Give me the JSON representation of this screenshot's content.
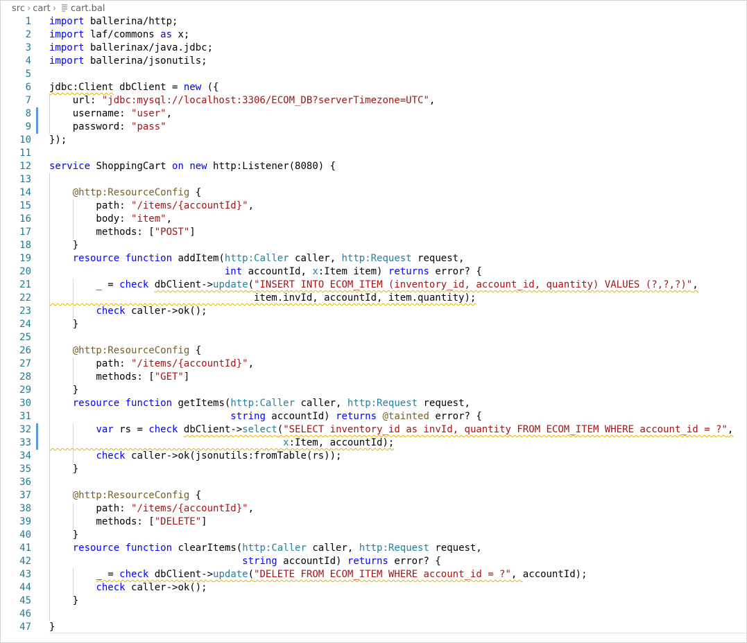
{
  "breadcrumb": {
    "items": [
      "src",
      "cart"
    ],
    "file": "cart.bal",
    "file_icon": "file-lines-icon"
  },
  "colors": {
    "keyword": "#0000ff",
    "string": "#a31515",
    "annotation": "#795e26",
    "type": "#267f99",
    "line_number": "#237893",
    "warning_squiggle": "#e5b300",
    "modified_gutter": "#5b9bd5"
  },
  "editor": {
    "modified_lines": [
      8,
      9,
      32,
      33
    ],
    "lines": [
      {
        "n": "1",
        "code": "import ballerina/http;"
      },
      {
        "n": "2",
        "code": "import laf/commons as x;"
      },
      {
        "n": "3",
        "code": "import ballerinax/java.jdbc;"
      },
      {
        "n": "4",
        "code": "import ballerina/jsonutils;"
      },
      {
        "n": "5",
        "code": ""
      },
      {
        "n": "6",
        "code": "jdbc:Client dbClient = new ({"
      },
      {
        "n": "7",
        "code": "    url: \"jdbc:mysql://localhost:3306/ECOM_DB?serverTimezone=UTC\","
      },
      {
        "n": "8",
        "code": "    username: \"user\","
      },
      {
        "n": "9",
        "code": "    password: \"pass\""
      },
      {
        "n": "10",
        "code": "});"
      },
      {
        "n": "11",
        "code": ""
      },
      {
        "n": "12",
        "code": "service ShoppingCart on new http:Listener(8080) {"
      },
      {
        "n": "13",
        "code": ""
      },
      {
        "n": "14",
        "code": "    @http:ResourceConfig {"
      },
      {
        "n": "15",
        "code": "        path: \"/items/{accountId}\","
      },
      {
        "n": "16",
        "code": "        body: \"item\","
      },
      {
        "n": "17",
        "code": "        methods: [\"POST\"]"
      },
      {
        "n": "18",
        "code": "    }"
      },
      {
        "n": "19",
        "code": "    resource function addItem(http:Caller caller, http:Request request,"
      },
      {
        "n": "20",
        "code": "                              int accountId, x:Item item) returns error? {"
      },
      {
        "n": "21",
        "code": "        _ = check dbClient->update(\"INSERT INTO ECOM_ITEM (inventory_id, account_id, quantity) VALUES (?,?,?)\","
      },
      {
        "n": "22",
        "code": "                                   item.invId, accountId, item.quantity);"
      },
      {
        "n": "23",
        "code": "        check caller->ok();"
      },
      {
        "n": "24",
        "code": "    }"
      },
      {
        "n": "25",
        "code": ""
      },
      {
        "n": "26",
        "code": "    @http:ResourceConfig {"
      },
      {
        "n": "27",
        "code": "        path: \"/items/{accountId}\","
      },
      {
        "n": "28",
        "code": "        methods: [\"GET\"]"
      },
      {
        "n": "29",
        "code": "    }"
      },
      {
        "n": "30",
        "code": "    resource function getItems(http:Caller caller, http:Request request,"
      },
      {
        "n": "31",
        "code": "                               string accountId) returns @tainted error? {"
      },
      {
        "n": "32",
        "code": "        var rs = check dbClient->select(\"SELECT inventory_id as invId, quantity FROM ECOM_ITEM WHERE account_id = ?\","
      },
      {
        "n": "33",
        "code": "                                        x:Item, accountId);"
      },
      {
        "n": "34",
        "code": "        check caller->ok(jsonutils:fromTable(rs));"
      },
      {
        "n": "35",
        "code": "    }"
      },
      {
        "n": "36",
        "code": ""
      },
      {
        "n": "37",
        "code": "    @http:ResourceConfig {"
      },
      {
        "n": "38",
        "code": "        path: \"/items/{accountId}\","
      },
      {
        "n": "39",
        "code": "        methods: [\"DELETE\"]"
      },
      {
        "n": "40",
        "code": "    }"
      },
      {
        "n": "41",
        "code": "    resource function clearItems(http:Caller caller, http:Request request,"
      },
      {
        "n": "42",
        "code": "                                 string accountId) returns error? {"
      },
      {
        "n": "43",
        "code": "        _ = check dbClient->update(\"DELETE FROM ECOM_ITEM WHERE account_id = ?\", accountId);"
      },
      {
        "n": "44",
        "code": "        check caller->ok();"
      },
      {
        "n": "45",
        "code": "    }"
      },
      {
        "n": "46",
        "code": ""
      },
      {
        "n": "47",
        "code": "}"
      }
    ]
  }
}
